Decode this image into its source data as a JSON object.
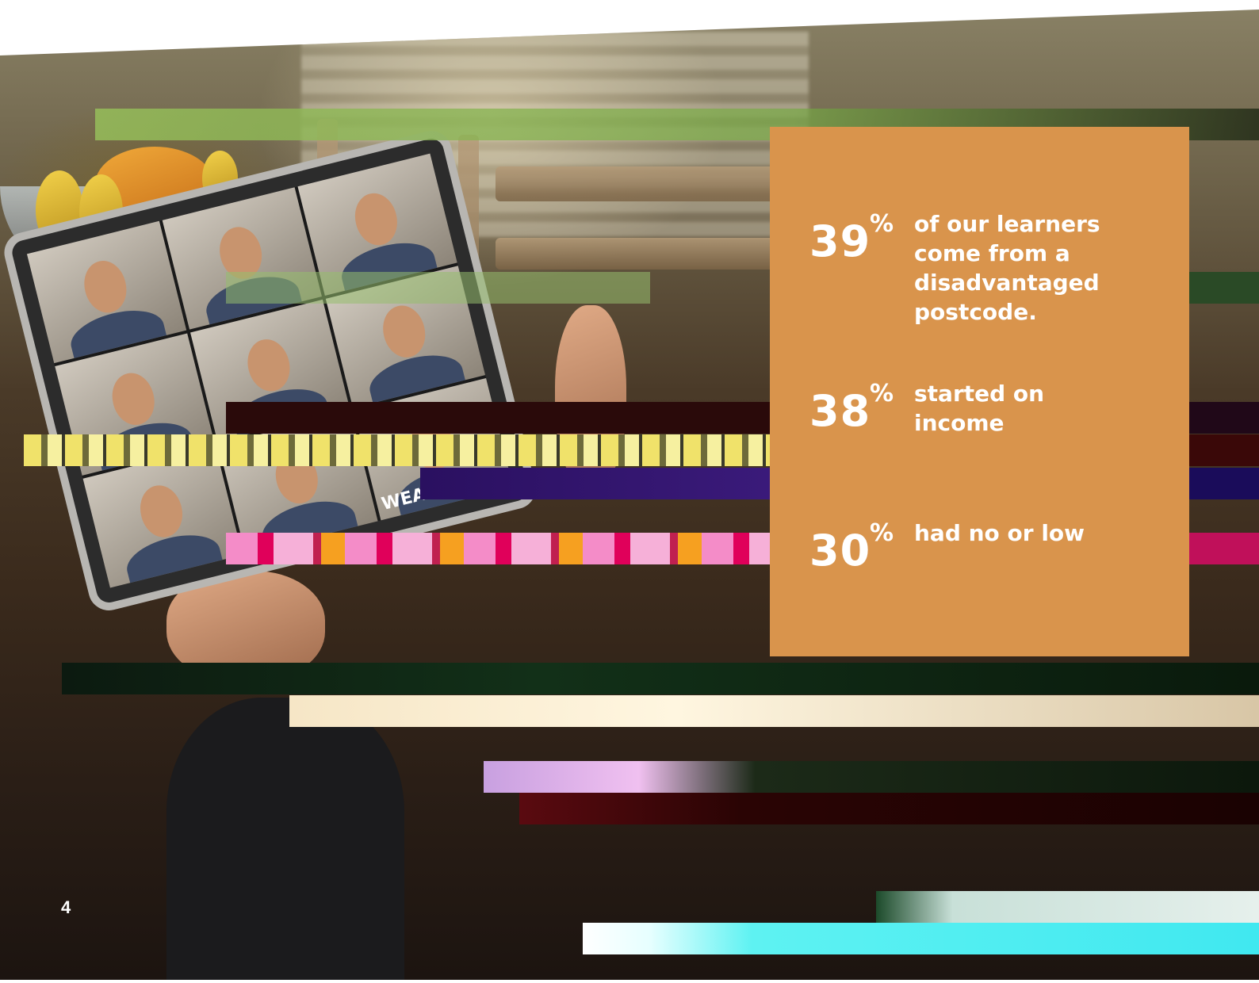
{
  "page": {
    "number": "4"
  },
  "colors": {
    "panel": "#d9944c",
    "text": "#ffffff"
  },
  "photo": {
    "tablet_logo": "WEA"
  },
  "stats": [
    {
      "value": "39",
      "unit": "%",
      "text": "of our learners\ncome from a\ndisadvantaged\npostcode."
    },
    {
      "value": "38",
      "unit": "%",
      "text": "started on\nincome"
    },
    {
      "value": "30",
      "unit": "%",
      "text": "had no or low"
    }
  ]
}
